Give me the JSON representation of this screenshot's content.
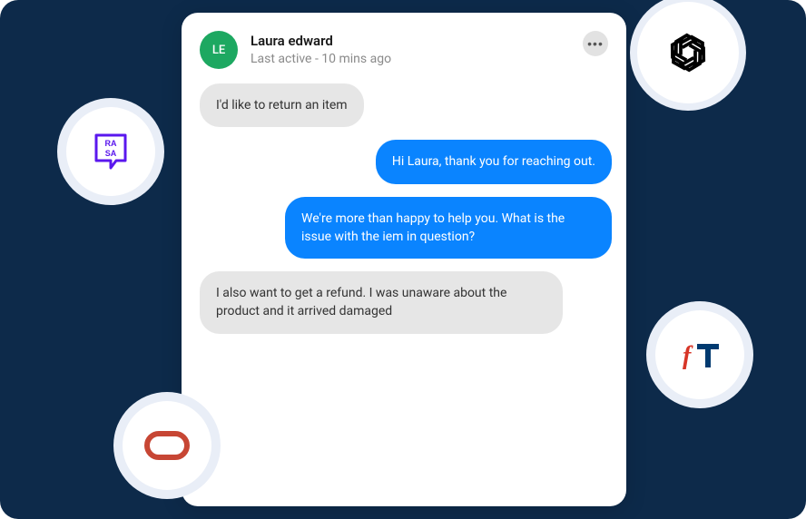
{
  "chat": {
    "user": {
      "name": "Laura edward",
      "initials": "LE",
      "last_active": "Last active - 10 mins ago"
    },
    "messages": [
      {
        "dir": "incoming",
        "text": "I'd like to return an item"
      },
      {
        "dir": "outgoing",
        "text": "Hi Laura, thank you for reaching out."
      },
      {
        "dir": "outgoing",
        "text": "We're more than happy to help you. What is the issue with the iem in question?"
      },
      {
        "dir": "incoming",
        "text": "I also want to get a refund. I was unaware about the product and it arrived damaged"
      }
    ]
  },
  "icons": {
    "openai": "openai-logo",
    "rasa": "rasa-logo",
    "oracle": "oracle-logo",
    "ft": "ft-logo"
  },
  "colors": {
    "bg": "#0d2a4a",
    "avatar": "#1da861",
    "outgoing": "#0a84ff",
    "incoming": "#e6e6e6",
    "rasa": "#5a17ee",
    "oracle": "#c74634",
    "ft_red": "#d73527",
    "ft_blue": "#003a70"
  }
}
